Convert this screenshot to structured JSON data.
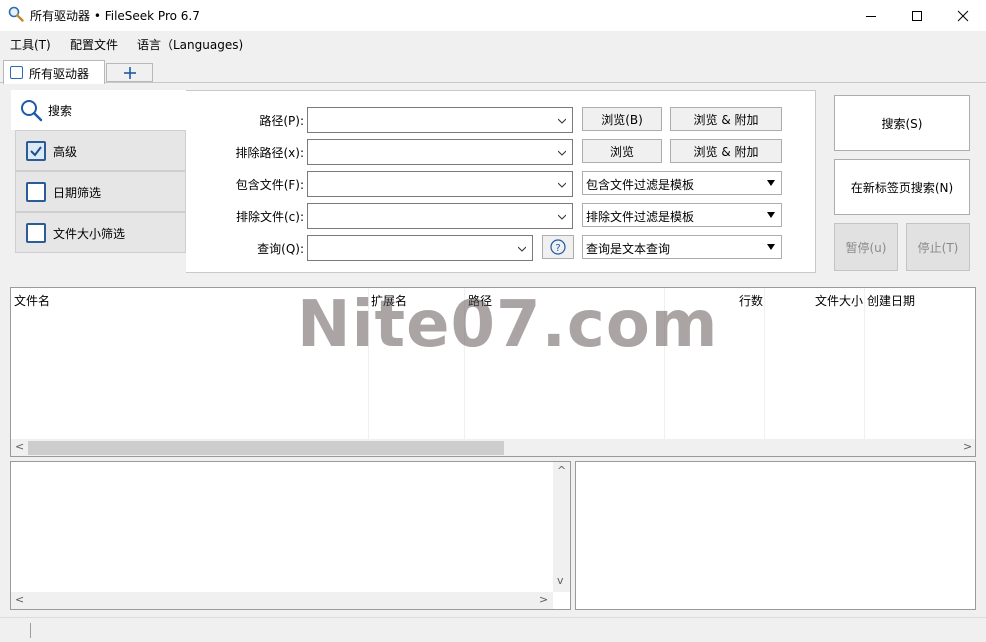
{
  "window": {
    "title": "所有驱动器 • FileSeek Pro 6.7",
    "app_icon": "magnifier-icon",
    "controls": [
      "minimize-icon",
      "maximize-icon",
      "close-icon"
    ]
  },
  "menu": {
    "items": [
      "工具(T)",
      "配置文件",
      "语言（Languages)"
    ]
  },
  "tabs": {
    "items": [
      {
        "label": "所有驱动器",
        "icon": "search-tab-icon"
      }
    ],
    "add_icon": "plus-icon"
  },
  "options": {
    "search_label": "搜索",
    "advanced_label": "高级",
    "date_filter_label": "日期筛选",
    "size_filter_label": "文件大小筛选",
    "advanced_checked": true,
    "date_filter_checked": false,
    "size_filter_checked": false
  },
  "form": {
    "path_label": "路径(P):",
    "exclude_path_label": "排除路径(x):",
    "include_files_label": "包含文件(F):",
    "exclude_files_label": "排除文件(c):",
    "query_label": "查询(Q):",
    "path_value": "",
    "exclude_path_value": "",
    "include_files_value": "",
    "exclude_files_value": "",
    "query_value": "",
    "browse_b_label": "浏览(B)",
    "browse_append_label": "浏览 & 附加",
    "browse_label": "浏览",
    "browse_append_label_2": "浏览 & 附加",
    "include_mode": "包含文件过滤是模板",
    "exclude_mode": "排除文件过滤是模板",
    "query_mode": "查询是文本查询",
    "help_icon": "question-circle-icon"
  },
  "actions": {
    "search_label": "搜索(S)",
    "search_new_tab_label": "在新标签页搜索(N)",
    "pause_label": "暂停(u)",
    "stop_label": "停止(T)"
  },
  "results": {
    "columns": [
      "文件名",
      "扩展名",
      "路径",
      "行数",
      "文件大小",
      "创建日期"
    ],
    "watermark": "Nite07.com"
  },
  "colors": {
    "accent": "#2b5c97",
    "checked_fill": "#dce9f7"
  }
}
